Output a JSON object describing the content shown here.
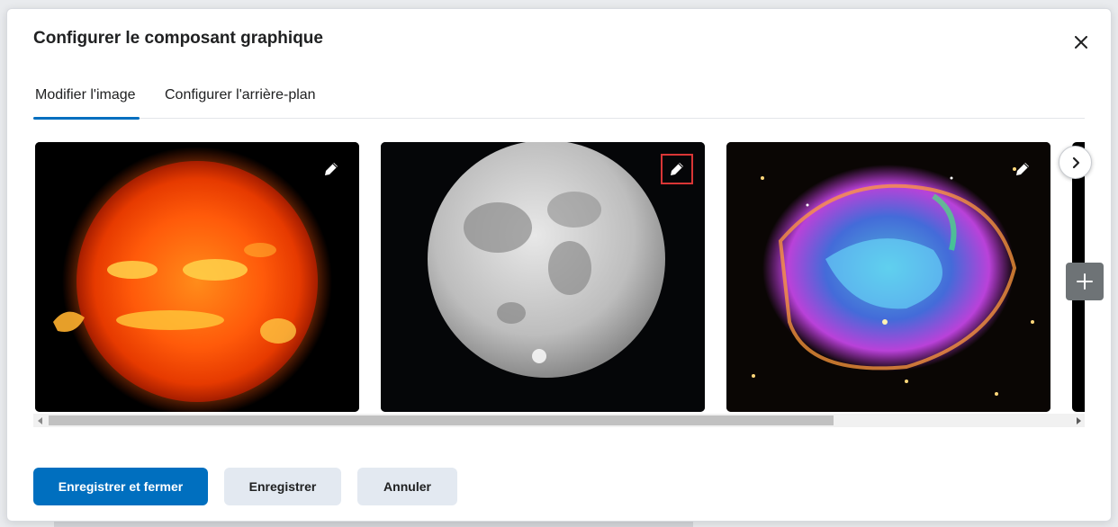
{
  "dialog": {
    "title": "Configurer le composant graphique",
    "close_icon": "close-icon"
  },
  "tabs": [
    {
      "label": "Modifier l'image",
      "active": true
    },
    {
      "label": "Configurer l'arrière-plan",
      "active": false
    }
  ],
  "images": [
    {
      "subject": "sun",
      "edit_icon": "pencil-icon"
    },
    {
      "subject": "moon",
      "edit_icon": "pencil-icon",
      "focused": true
    },
    {
      "subject": "supernova-remnant",
      "edit_icon": "pencil-icon"
    }
  ],
  "carousel": {
    "next_icon": "chevron-right-icon",
    "add_icon": "plus-icon"
  },
  "footer": {
    "save_close_label": "Enregistrer et fermer",
    "save_label": "Enregistrer",
    "cancel_label": "Annuler"
  },
  "colors": {
    "primary": "#006fbf",
    "secondary_button": "#e3e9f1",
    "focus_outline": "#d93636"
  }
}
